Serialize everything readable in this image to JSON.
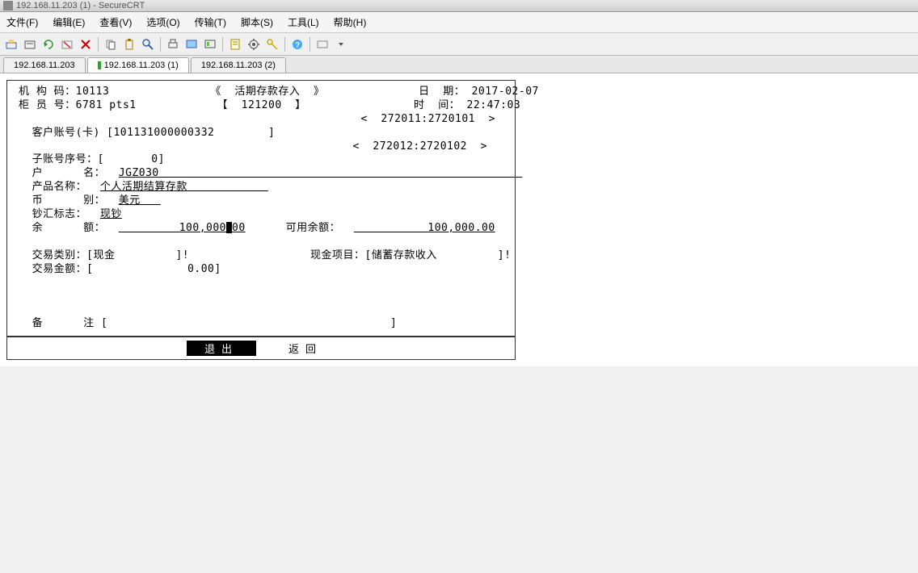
{
  "window": {
    "title": "192.168.11.203 (1) - SecureCRT"
  },
  "menu": {
    "file": "文件(F)",
    "edit": "编辑(E)",
    "view": "查看(V)",
    "options": "选项(O)",
    "transfer": "传输(T)",
    "script": "脚本(S)",
    "tools": "工具(L)",
    "help": "帮助(H)"
  },
  "tabs": [
    {
      "label": "192.168.11.203"
    },
    {
      "label": "192.168.11.203 (1)"
    },
    {
      "label": "192.168.11.203 (2)"
    }
  ],
  "form": {
    "org_code_label": "机 构 码：",
    "org_code": "10113",
    "screen_title": "《  活期存款存入  》",
    "date_label": "日  期：",
    "date": "2017-02-07",
    "teller_label": "柜 员 号：",
    "teller": "6781 pts1",
    "screen_code": "【  121200  】",
    "time_label": "时  间：",
    "time": "22:47:03",
    "nav1": "<  272011:2720101  >",
    "nav2": "<  272012:2720102  >",
    "cust_acct_label": "客户账号(卡) ",
    "cust_acct": "[101131000000332        ]",
    "sub_acct_label": "子账号序号：",
    "sub_acct": "[       0]",
    "acct_name_label": "户      名：",
    "acct_name": "JGZ030",
    "product_label": "产品名称：",
    "product": "个人活期结算存款",
    "currency_label": "币      别：",
    "currency": "美元",
    "cash_flag_label": "钞汇标志：",
    "cash_flag": "现钞",
    "balance_label": "余      额：",
    "balance": "100,000.00",
    "avail_label": "可用余额：",
    "avail": "100,000.00",
    "txn_type_label": "交易类别：",
    "txn_type": "[现金         ]!",
    "cash_item_label": "现金项目：",
    "cash_item": "[储蓄存款收入         ]!",
    "txn_amt_label": "交易金额：",
    "txn_amt": "[              0.00]",
    "remark_label": "备      注",
    "remark": "[                                          ]"
  },
  "footer": {
    "exit": "退出",
    "back": "返回"
  }
}
